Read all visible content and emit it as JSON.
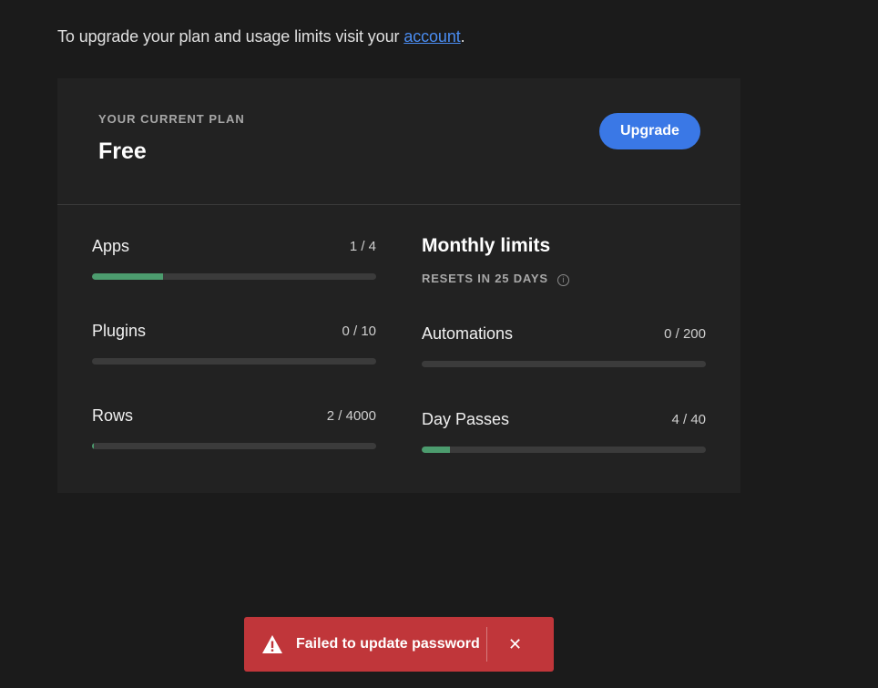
{
  "intro": {
    "text_before": "To upgrade your plan and usage limits visit your ",
    "link_label": "account",
    "text_after": "."
  },
  "plan": {
    "eyebrow": "YOUR CURRENT PLAN",
    "name": "Free",
    "upgrade_label": "Upgrade"
  },
  "usage": [
    {
      "label": "Apps",
      "count": "1 / 4",
      "fraction": 0.25
    },
    {
      "label": "Plugins",
      "count": "0 / 10",
      "fraction": 0.0
    },
    {
      "label": "Rows",
      "count": "2 / 4000",
      "fraction": 0.0005
    }
  ],
  "monthly": {
    "title": "Monthly limits",
    "resets": "RESETS IN 25 DAYS",
    "items": [
      {
        "label": "Automations",
        "count": "0 / 200",
        "fraction": 0.0
      },
      {
        "label": "Day Passes",
        "count": "4 / 40",
        "fraction": 0.1
      }
    ]
  },
  "toast": {
    "message": "Failed to update password",
    "close_glyph": "✕"
  },
  "colors": {
    "accent": "#3a78e6",
    "progress": "#4c9c6e",
    "error": "#c0363a"
  }
}
